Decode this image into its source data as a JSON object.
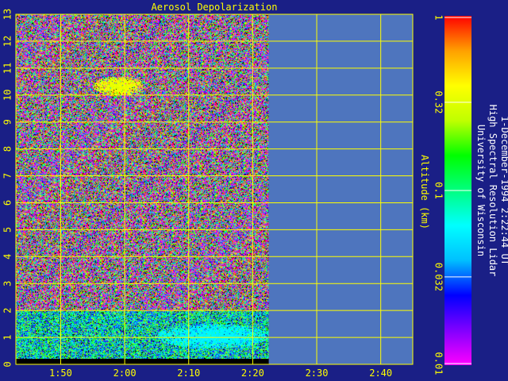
{
  "chart_data": {
    "type": "heatmap",
    "title": "Aerosol Depolarization",
    "ylabel": "Altitude (km)",
    "y_ticks": [
      "0",
      "1",
      "2",
      "3",
      "4",
      "5",
      "6",
      "7",
      "8",
      "9",
      "10",
      "11",
      "12",
      "13"
    ],
    "ylim": [
      0,
      13
    ],
    "x_ticks": [
      "1:50",
      "2:00",
      "2:10",
      "2:20",
      "2:30",
      "2:40"
    ],
    "x_tick_minutes": [
      110,
      120,
      130,
      140,
      150,
      160
    ],
    "xlim_minutes": [
      103,
      165
    ],
    "data_end_minutes": [
      142.5
    ],
    "grid": true,
    "colorbar": {
      "scale": "log",
      "range": [
        0.01,
        1
      ],
      "tick_labels": [
        "1",
        "0.32",
        "0.1",
        "0.032",
        "0.01"
      ],
      "tick_values": [
        1,
        0.32,
        0.1,
        0.032,
        0.01
      ],
      "colors": [
        "#ff00ff",
        "#8000ff",
        "#0000ff",
        "#00c0ff",
        "#00ffff",
        "#00ff80",
        "#00ff00",
        "#c0ff00",
        "#ffff00",
        "#ffa000",
        "#ff0000"
      ]
    },
    "features": [
      {
        "label": "high depolarization layer",
        "x_minutes": [
          115,
          123
        ],
        "altitude_km": [
          10.0,
          10.7
        ],
        "value": 0.35
      },
      {
        "label": "low depolarization boundary layer",
        "x_minutes": [
          125,
          142.5
        ],
        "altitude_km": [
          0.6,
          1.5
        ],
        "value": 0.06
      }
    ]
  },
  "annotation": {
    "line1": "University of Wisconsin",
    "line2": "High Spectral Resolution Lidar",
    "line3": "1-December-1994  2:22:44 UT"
  },
  "colors": {
    "background": "#1a1f86",
    "no_data": "#4e75be",
    "grid": "#ffff00",
    "text": "#ffff00",
    "annotation": "#ffffff"
  }
}
